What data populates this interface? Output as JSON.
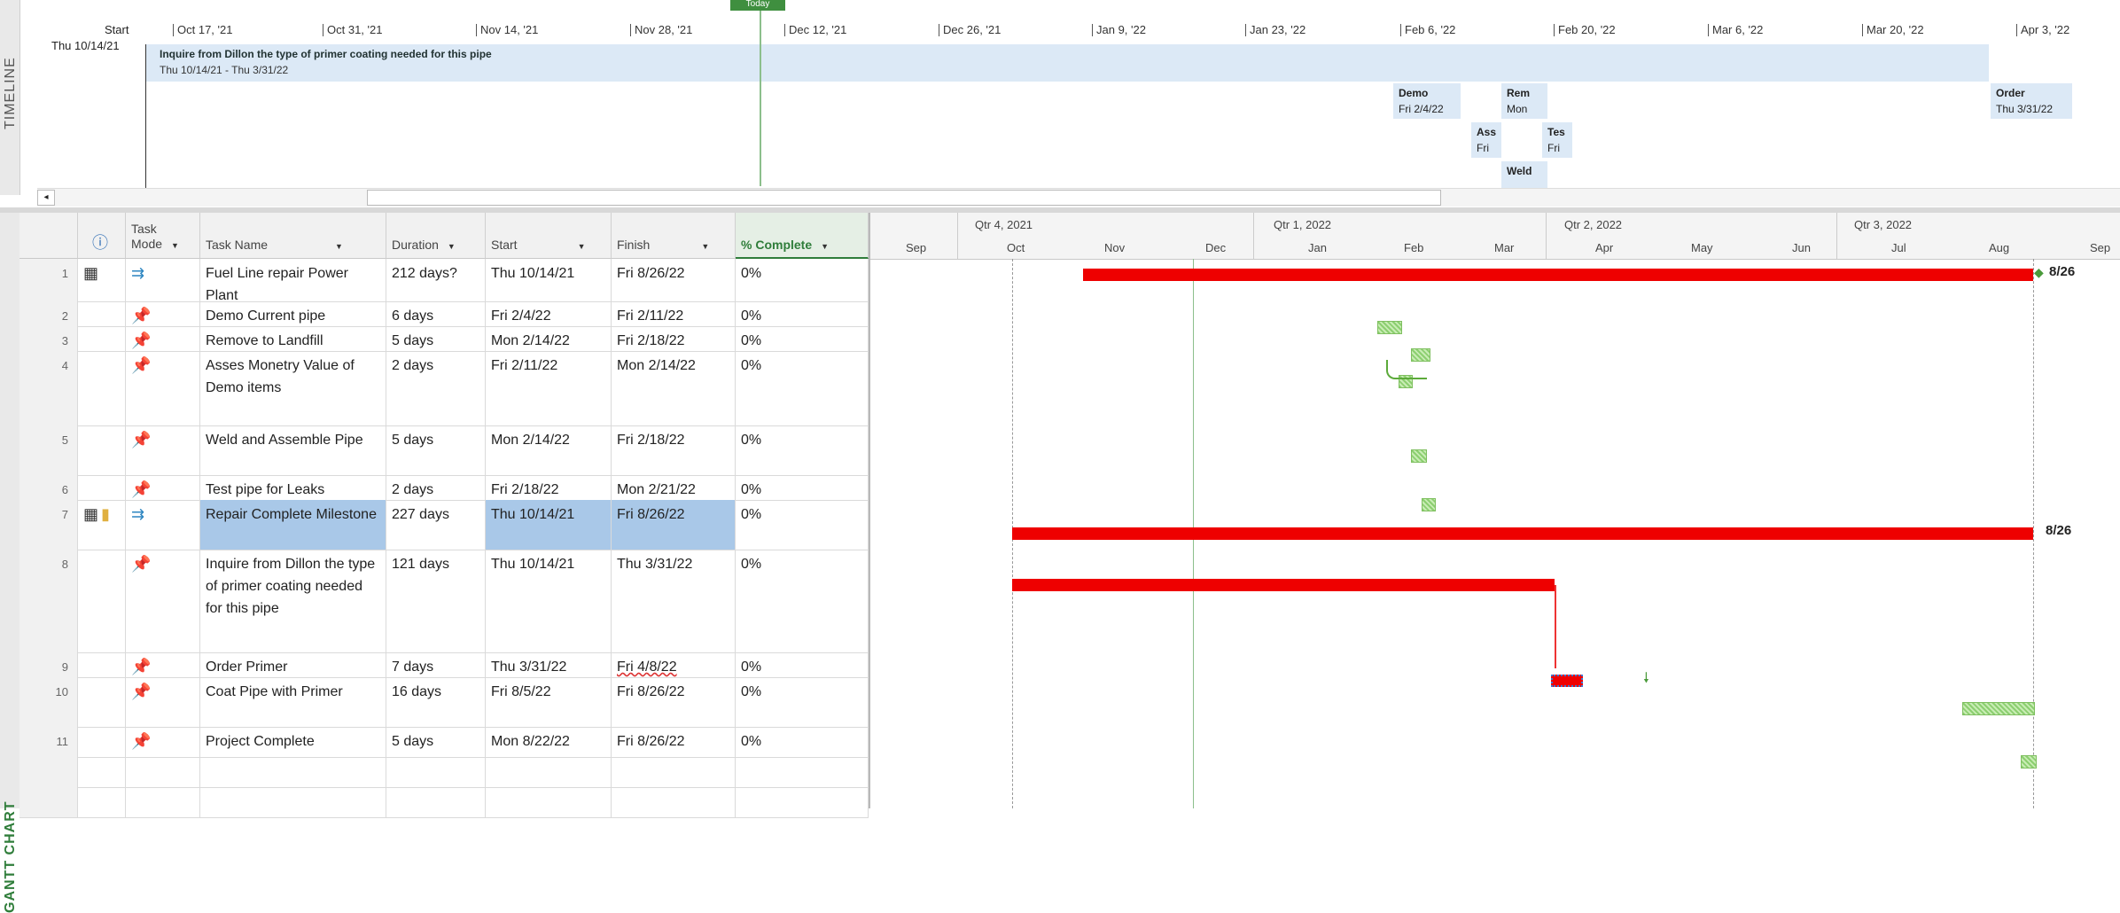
{
  "side_labels": {
    "timeline": "TIMELINE",
    "gantt": "GANTT CHART"
  },
  "timeline": {
    "today_label": "Today",
    "start_label": "Start",
    "start_date": "Thu 10/14/21",
    "dates": [
      "Oct 17, '21",
      "Oct 31, '21",
      "Nov 14, '21",
      "Nov 28, '21",
      "Dec 12, '21",
      "Dec 26, '21",
      "Jan 9, '22",
      "Jan 23, '22",
      "Feb 6, '22",
      "Feb 20, '22",
      "Mar 6, '22",
      "Mar 20, '22",
      "Apr 3, '22"
    ],
    "main_bar": {
      "title": "Inquire from Dillon the type of primer coating needed for this pipe",
      "dates": "Thu 10/14/21 - Thu 3/31/22"
    },
    "items": [
      {
        "name": "Demo",
        "date": "Fri 2/4/22"
      },
      {
        "name": "Rem",
        "date": "Mon"
      },
      {
        "name": "Ass",
        "date": "Fri"
      },
      {
        "name": "Tes",
        "date": "Fri"
      },
      {
        "name": "Weld",
        "date": ""
      },
      {
        "name": "Order",
        "date": "Thu 3/31/22"
      }
    ],
    "scroll_left": "◂"
  },
  "table": {
    "headers": {
      "info": "ⓘ",
      "mode_line1": "Task",
      "mode_line2": "Mode",
      "name": "Task Name",
      "duration": "Duration",
      "start": "Start",
      "finish": "Finish",
      "pct": "% Complete"
    },
    "rows": [
      {
        "id": "1",
        "name": "Fuel Line repair Power Plant",
        "duration": "212 days?",
        "start": "Thu 10/14/21",
        "finish": "Fri 8/26/22",
        "pct": "0%"
      },
      {
        "id": "2",
        "name": "Demo Current pipe",
        "duration": "6 days",
        "start": "Fri 2/4/22",
        "finish": "Fri 2/11/22",
        "pct": "0%"
      },
      {
        "id": "3",
        "name": "Remove to Landfill",
        "duration": "5 days",
        "start": "Mon 2/14/22",
        "finish": "Fri 2/18/22",
        "pct": "0%"
      },
      {
        "id": "4",
        "name": "Asses Monetry Value of Demo items",
        "duration": "2 days",
        "start": "Fri 2/11/22",
        "finish": "Mon 2/14/22",
        "pct": "0%"
      },
      {
        "id": "5",
        "name": "Weld and Assemble Pipe",
        "duration": "5 days",
        "start": "Mon 2/14/22",
        "finish": "Fri 2/18/22",
        "pct": "0%"
      },
      {
        "id": "6",
        "name": "Test pipe for Leaks",
        "duration": "2 days",
        "start": "Fri 2/18/22",
        "finish": "Mon 2/21/22",
        "pct": "0%"
      },
      {
        "id": "7",
        "name": "Repair Complete Milestone",
        "duration": "227 days",
        "start": "Thu 10/14/21",
        "finish": "Fri 8/26/22",
        "pct": "0%"
      },
      {
        "id": "8",
        "name": "Inquire from Dillon the type of primer coating needed for this pipe",
        "duration": "121 days",
        "start": "Thu 10/14/21",
        "finish": "Thu 3/31/22",
        "pct": "0%"
      },
      {
        "id": "9",
        "name": "Order Primer",
        "duration": "7 days",
        "start": "Thu 3/31/22",
        "finish": "Fri 4/8/22",
        "pct": "0%"
      },
      {
        "id": "10",
        "name": "Coat Pipe with Primer",
        "duration": "16 days",
        "start": "Fri 8/5/22",
        "finish": "Fri 8/26/22",
        "pct": "0%"
      },
      {
        "id": "11",
        "name": "Project Complete",
        "duration": "5 days",
        "start": "Mon 8/22/22",
        "finish": "Fri 8/26/22",
        "pct": "0%"
      }
    ]
  },
  "chart": {
    "quarters": [
      "Qtr 4, 2021",
      "Qtr 1, 2022",
      "Qtr 2, 2022",
      "Qtr 3, 2022"
    ],
    "months": [
      "Sep",
      "Oct",
      "Nov",
      "Dec",
      "Jan",
      "Feb",
      "Mar",
      "Apr",
      "May",
      "Jun",
      "Jul",
      "Aug",
      "Sep"
    ],
    "labels": {
      "row1": "8/26",
      "row7": "8/26"
    }
  },
  "colors": {
    "critical": "#ee0000",
    "manual_task": "#8ccf70",
    "accent": "#2f7d3a"
  }
}
